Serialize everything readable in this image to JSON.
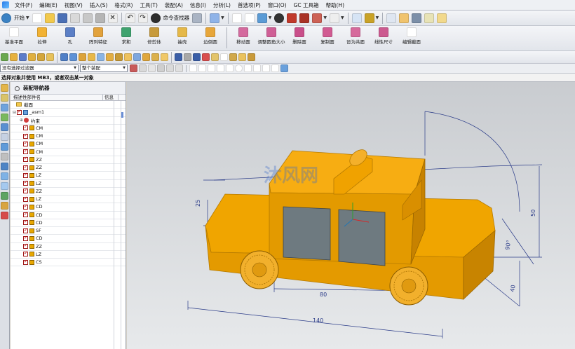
{
  "menu": {
    "items": [
      "文件(F)",
      "编辑(E)",
      "视图(V)",
      "插入(S)",
      "格式(R)",
      "工具(T)",
      "装配(A)",
      "信息(I)",
      "分析(L)",
      "首选项(P)",
      "窗口(O)",
      "GC 工具箱",
      "帮助(H)"
    ]
  },
  "toolbar1": {
    "start_label": "开始",
    "command_finder_label": "命令查找器"
  },
  "toolbar2": {
    "buttons": [
      "基准平面",
      "拉伸",
      "孔",
      "阵列特征",
      "求和",
      "修剪体",
      "抽壳",
      "边倒圆",
      "移动面",
      "调整圆角大小",
      "删除面",
      "复制面",
      "设为共面",
      "线性尺寸",
      "编辑截面"
    ]
  },
  "filter": {
    "type_filter": "没有选择过滤器",
    "scope": "整个装配"
  },
  "status": {
    "prompt": "选择对象并使用 MB3，或者双击某一对象"
  },
  "navigator": {
    "title": "装配导航器",
    "col_name": "描述性部件名",
    "col_info": "信息",
    "section_label": "截面",
    "root_label": "_asm1",
    "constraints_label": "约束",
    "parts": [
      "CM",
      "CM",
      "CM",
      "CM",
      "ZZ",
      "ZZ",
      "LZ",
      "LZ",
      "ZZ",
      "LZ",
      "CD",
      "CD",
      "CD",
      "SF",
      "CD",
      "ZZ",
      "LZ",
      "CS"
    ]
  },
  "model": {
    "body_color": "#f5a800",
    "window_color": "#6e7a80",
    "dimensions": [
      "25",
      "50",
      "80",
      "140",
      "90°",
      "40"
    ],
    "watermark": "沐风网"
  },
  "colors": {
    "checkbox_tick": "#c00000",
    "dimension_line": "#2a3b88",
    "viewport_top": "#c9ccd0",
    "viewport_bottom": "#e7e9eb"
  }
}
